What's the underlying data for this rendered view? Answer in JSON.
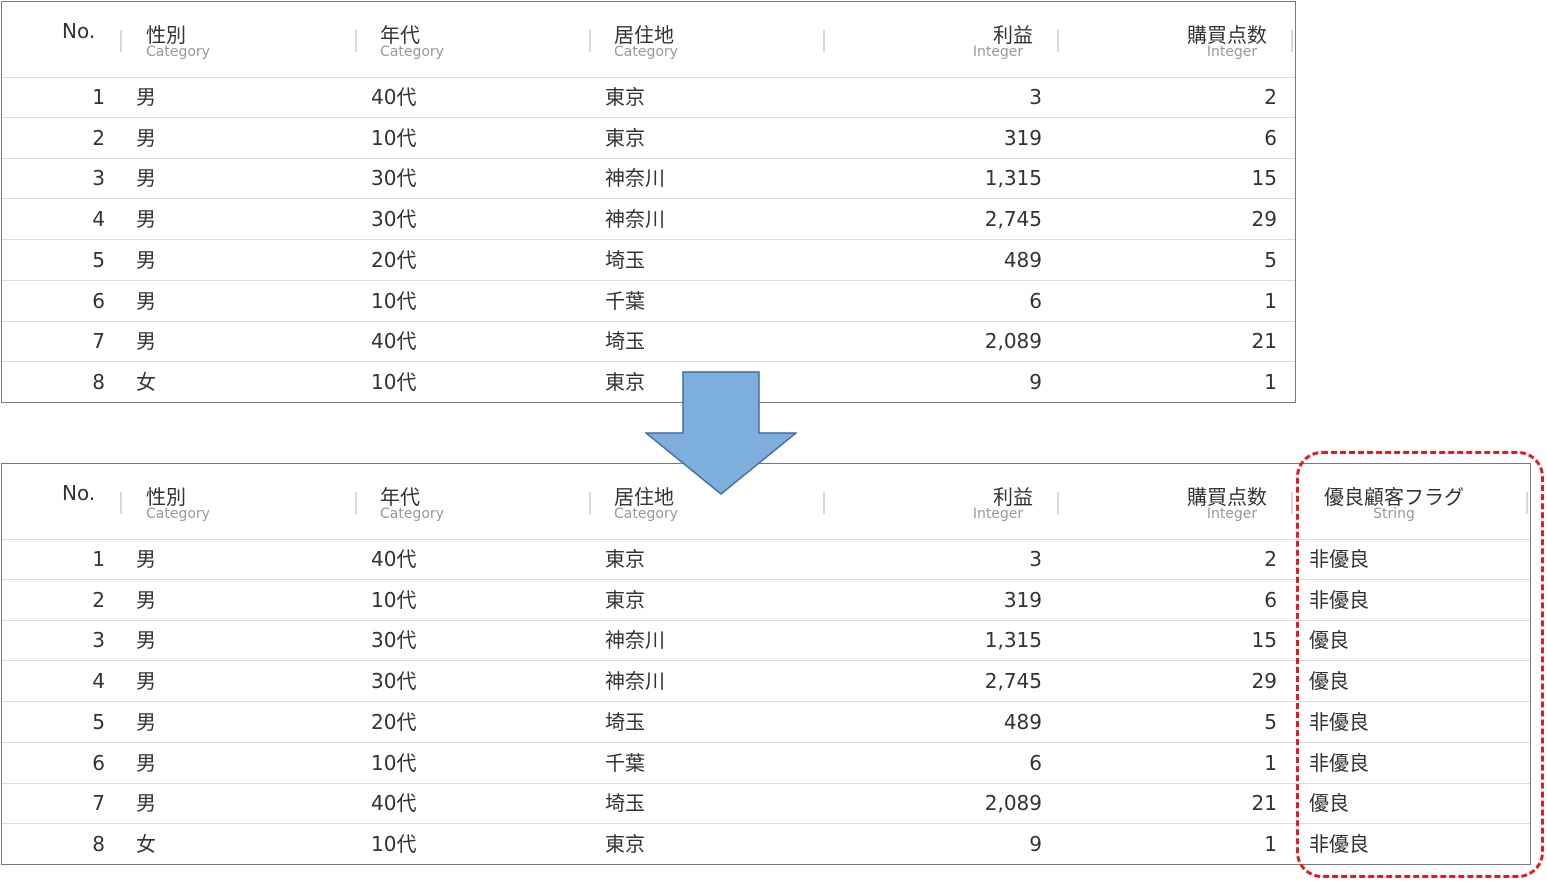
{
  "columns_before": [
    {
      "name": "No.",
      "type": ""
    },
    {
      "name": "性別",
      "type": "Category"
    },
    {
      "name": "年代",
      "type": "Category"
    },
    {
      "name": "居住地",
      "type": "Category"
    },
    {
      "name": "利益",
      "type": "Integer"
    },
    {
      "name": "購買点数",
      "type": "Integer"
    }
  ],
  "columns_after": [
    {
      "name": "No.",
      "type": ""
    },
    {
      "name": "性別",
      "type": "Category"
    },
    {
      "name": "年代",
      "type": "Category"
    },
    {
      "name": "居住地",
      "type": "Category"
    },
    {
      "name": "利益",
      "type": "Integer"
    },
    {
      "name": "購買点数",
      "type": "Integer"
    },
    {
      "name": "優良顧客フラグ",
      "type": "String"
    }
  ],
  "rows": [
    [
      "1",
      "男",
      "40代",
      "東京",
      "3",
      "2",
      "非優良"
    ],
    [
      "2",
      "男",
      "10代",
      "東京",
      "319",
      "6",
      "非優良"
    ],
    [
      "3",
      "男",
      "30代",
      "神奈川",
      "1,315",
      "15",
      "優良"
    ],
    [
      "4",
      "男",
      "30代",
      "神奈川",
      "2,745",
      "29",
      "優良"
    ],
    [
      "5",
      "男",
      "20代",
      "埼玉",
      "489",
      "5",
      "非優良"
    ],
    [
      "6",
      "男",
      "10代",
      "千葉",
      "6",
      "1",
      "非優良"
    ],
    [
      "7",
      "男",
      "40代",
      "埼玉",
      "2,089",
      "21",
      "優良"
    ],
    [
      "8",
      "女",
      "10代",
      "東京",
      "9",
      "1",
      "非優良"
    ]
  ],
  "colors": {
    "arrow_fill": "#7eaedc",
    "arrow_stroke": "#3f6ea5",
    "highlight": "#e8181f",
    "table_border": "#7a7a7a"
  }
}
